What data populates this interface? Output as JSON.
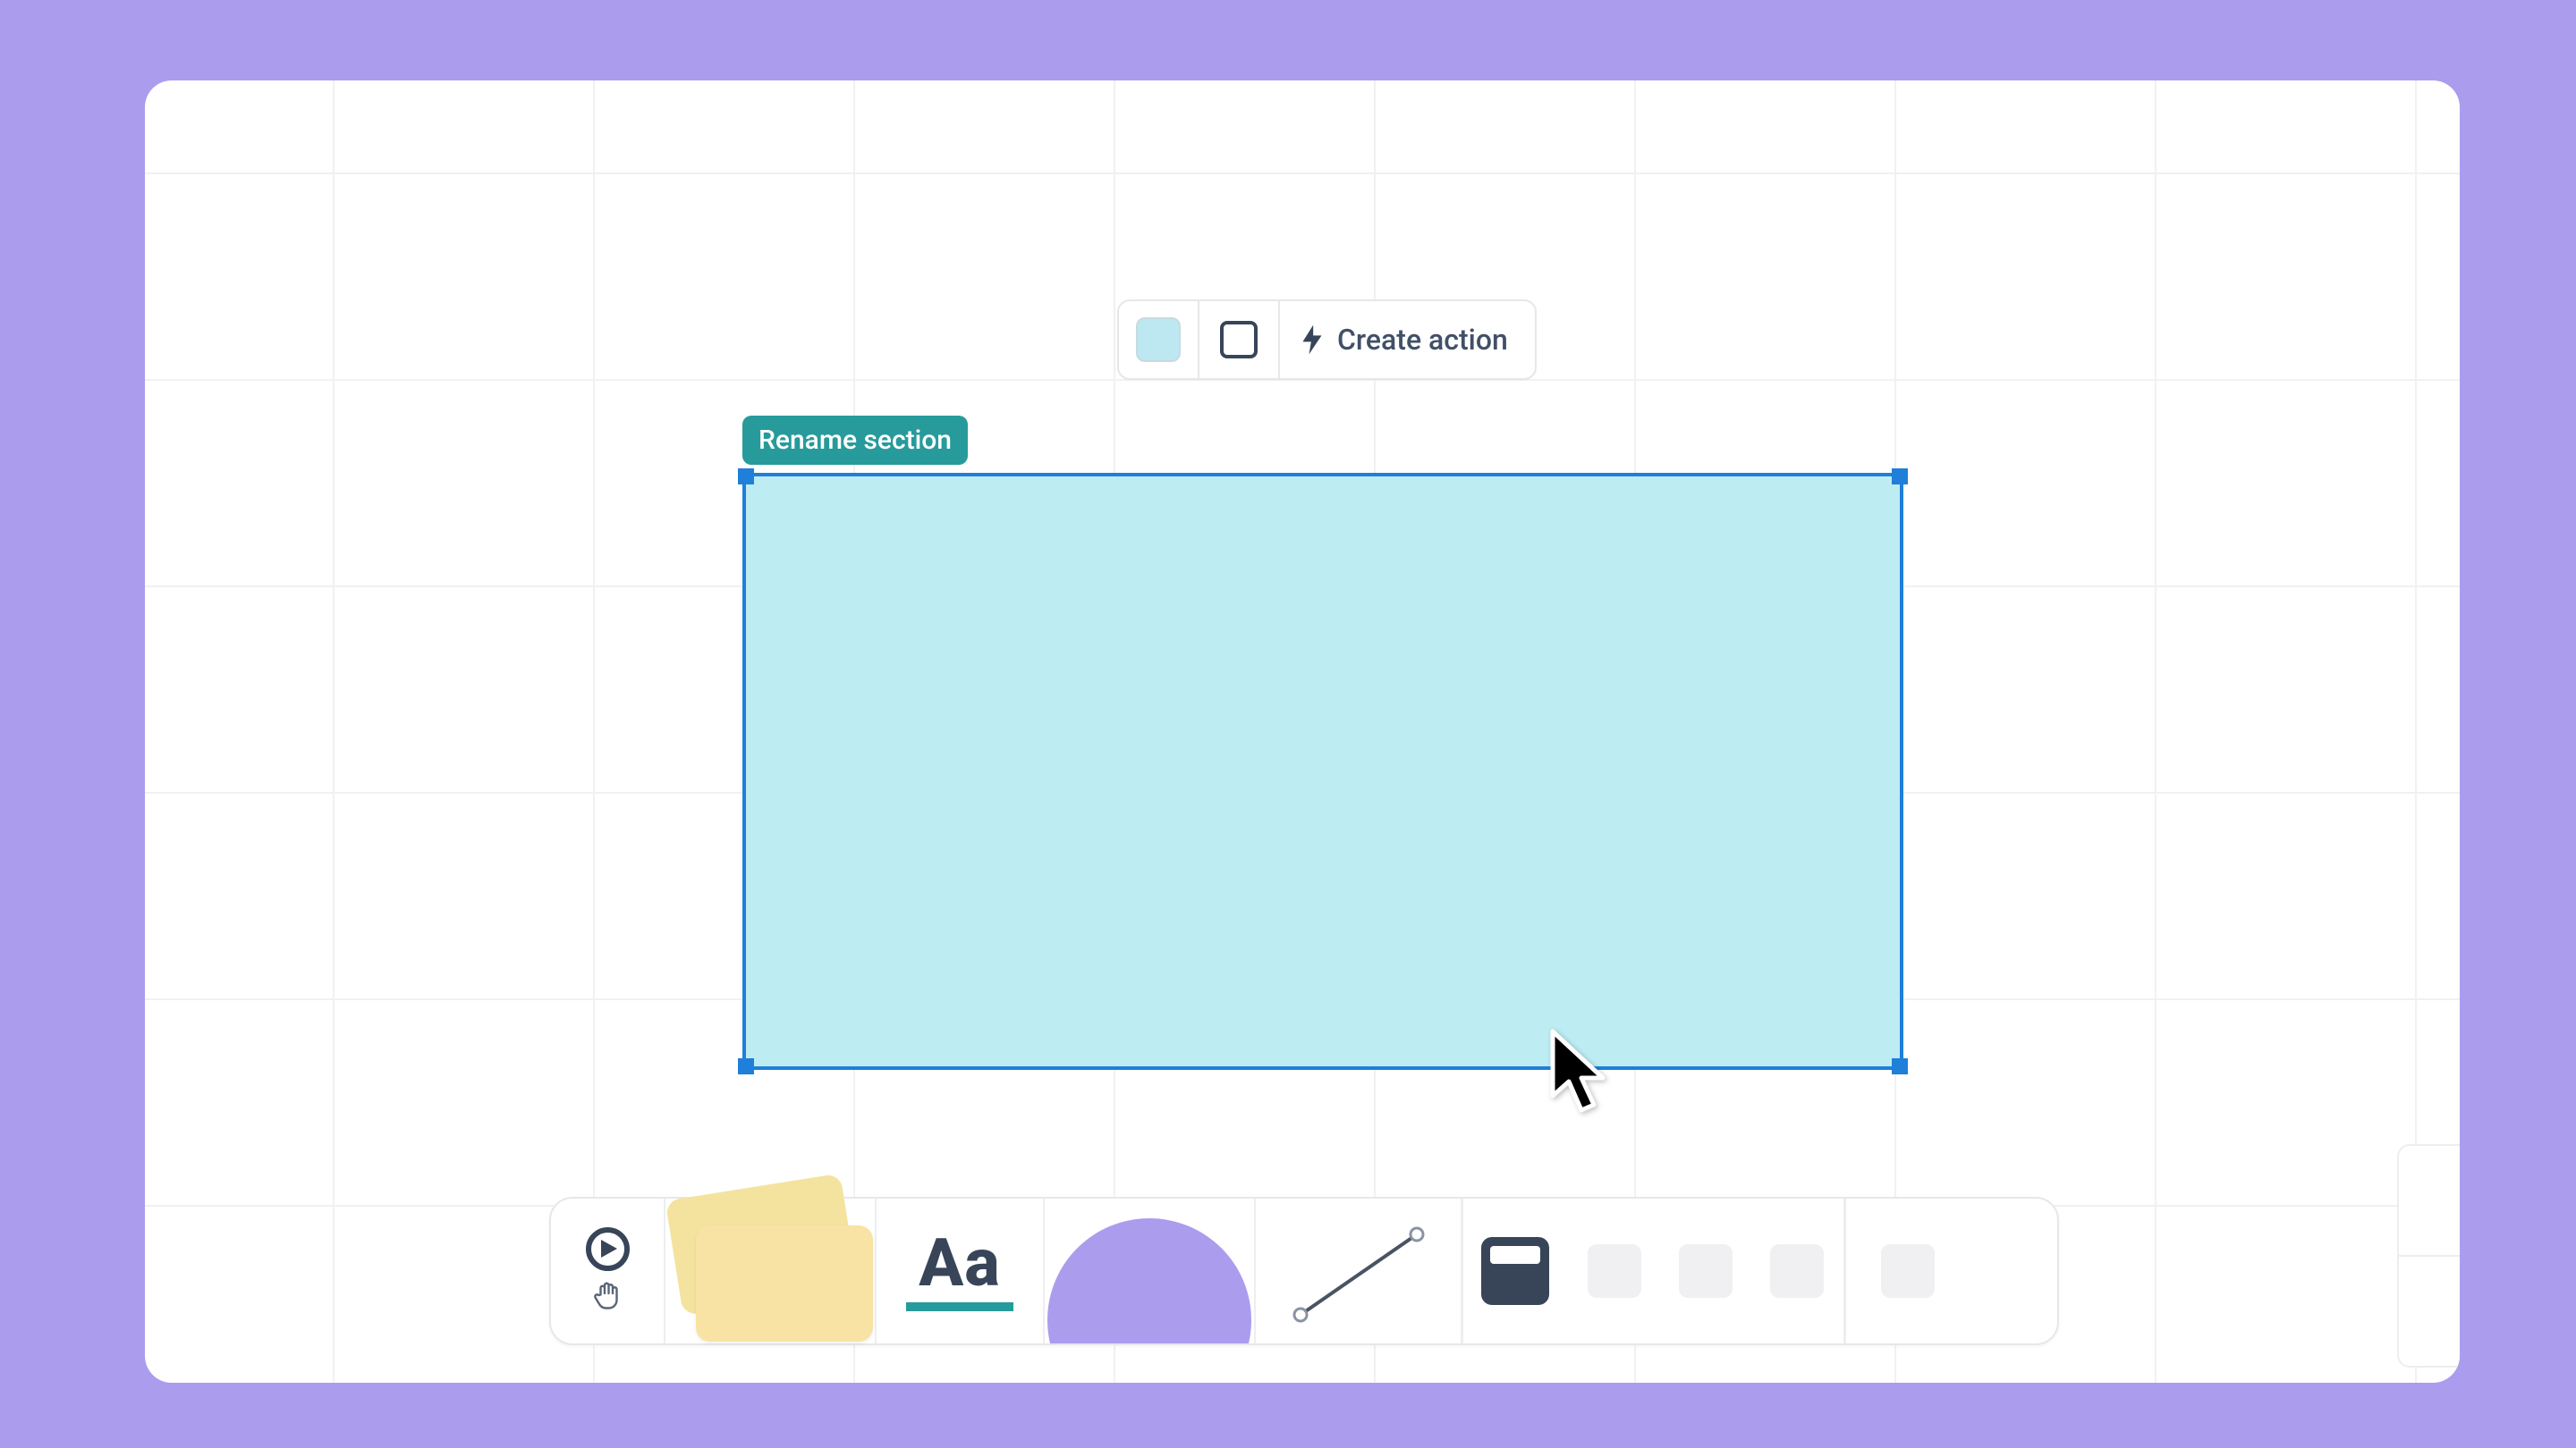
{
  "context_toolbar": {
    "swatch_color": "#bde8f1",
    "create_action_label": "Create action"
  },
  "section": {
    "chip_label": "Rename section",
    "fill_color": "#bdecf2",
    "border_color": "#1f7fd9"
  },
  "text_tool": {
    "glyph": "Aa"
  },
  "colors": {
    "background": "#ac9cee",
    "teal": "#279b9b",
    "ink": "#384559"
  }
}
